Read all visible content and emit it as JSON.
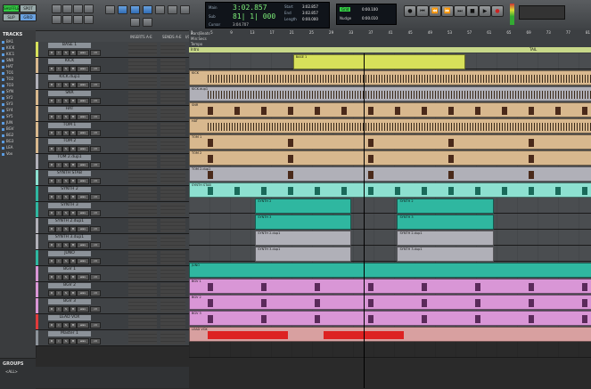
{
  "toolbar": {
    "modes": [
      "SHUFFLE",
      "SPOT",
      "SLIP",
      "GRID"
    ],
    "counter": {
      "main_label": "Main",
      "main_value": "3:02.857",
      "sub_label": "Sub",
      "sub_value": "81| 1| 000",
      "start_label": "Start",
      "start_value": "3:02.857",
      "end_label": "End",
      "end_value": "3:02.857",
      "length_label": "Length",
      "length_value": "0:00.000",
      "cursor_label": "Cursor",
      "cursor_value": "3:04.707"
    },
    "grid": {
      "label": "Grid",
      "value": "0:00.100",
      "nudge_label": "Nudge",
      "nudge_value": "0:00.010"
    }
  },
  "tracklist": {
    "title": "TRACKS",
    "items": [
      "BA1",
      "KICK",
      "KIC1",
      "SNR",
      "HAT",
      "TO1",
      "TO2",
      "TO3",
      "SYN",
      "SY2",
      "SY3",
      "SY4",
      "SY5",
      "JUN",
      "BGV",
      "BG2",
      "BG3",
      "LEA",
      "Vox"
    ]
  },
  "groups": {
    "title": "GROUPS",
    "all": "<ALL>"
  },
  "column_headers": {
    "inserts": "INSERTS A-E",
    "sends": "SENDS A-E",
    "io": "I/O"
  },
  "ruler": [
    "Bars|Beats",
    "Min:Secs",
    "Tempo",
    "Markers"
  ],
  "ruler_bars": [
    "1",
    "5",
    "9",
    "13",
    "17",
    "21",
    "25",
    "29",
    "33",
    "37",
    "41",
    "45",
    "49",
    "53",
    "57",
    "61",
    "65",
    "69",
    "73",
    "77",
    "81"
  ],
  "markers": {
    "intro": "Intro",
    "tail": "TAIL"
  },
  "tracks": [
    {
      "name": "BASE 1",
      "color": "#d7e15a",
      "io": "BASS",
      "vol": "-10.7",
      "clips": [
        [
          22,
          58
        ]
      ],
      "ctype": "wave"
    },
    {
      "name": "KICK",
      "color": "#d8b88e",
      "io": "DrmSub",
      "vol": "0.0",
      "clips": [
        [
          0,
          85
        ]
      ],
      "ctype": "dense"
    },
    {
      "name": "KICK.dup1",
      "color": "#b0b0b8",
      "io": "DrmSub",
      "vol": "0.0",
      "clips": [
        [
          0,
          85
        ]
      ],
      "ctype": "dense"
    },
    {
      "name": "SNR",
      "color": "#d8b88e",
      "io": "DrmSub",
      "vol": "0.0",
      "clips": [
        [
          0,
          85
        ]
      ],
      "ctype": "hits"
    },
    {
      "name": "HAT",
      "color": "#d8b88e",
      "io": "DrmSub",
      "vol": "0.0",
      "clips": [
        [
          0,
          85
        ]
      ],
      "ctype": "dense2"
    },
    {
      "name": "TOM 1",
      "color": "#d8b88e",
      "io": "DrmSub",
      "vol": "0.0",
      "clips": [
        [
          0,
          85
        ]
      ],
      "ctype": "sparse"
    },
    {
      "name": "TOM 2",
      "color": "#d8b88e",
      "io": "DrmSub",
      "vol": "0.0",
      "clips": [
        [
          0,
          85
        ]
      ],
      "ctype": "sparse"
    },
    {
      "name": "TOM 2.dup1",
      "color": "#b0b0b8",
      "io": "DrmSub",
      "vol": "0.0",
      "clips": [
        [
          0,
          85
        ]
      ],
      "ctype": "sparse"
    },
    {
      "name": "SYNTH STAB",
      "color": "#8de0d0",
      "io": "SynSub",
      "vol": "0.0",
      "clips": [
        [
          0,
          85
        ]
      ],
      "ctype": "stab"
    },
    {
      "name": "SYNTH 2",
      "color": "#2fb7a0",
      "io": "SynSub",
      "vol": "+6.0",
      "clips": [
        [
          14,
          34
        ],
        [
          44,
          64
        ]
      ],
      "ctype": "block"
    },
    {
      "name": "SYNTH 3",
      "color": "#2fb7a0",
      "io": "SynSub",
      "vol": "0.0",
      "clips": [
        [
          14,
          34
        ],
        [
          44,
          64
        ]
      ],
      "ctype": "block"
    },
    {
      "name": "SYNTH 2.dup1",
      "color": "#b0b0b8",
      "io": "SynSub",
      "vol": "0.0",
      "clips": [
        [
          14,
          34
        ],
        [
          44,
          64
        ]
      ],
      "ctype": "block"
    },
    {
      "name": "SYNTH 3.dup1",
      "color": "#b0b0b8",
      "io": "SynSub",
      "vol": "0.0",
      "clips": [
        [
          14,
          34
        ],
        [
          44,
          64
        ]
      ],
      "ctype": "block"
    },
    {
      "name": "JUNO",
      "color": "#2fb7a0",
      "io": "SynSub",
      "vol": "0.0",
      "clips": [
        [
          0,
          85
        ]
      ],
      "ctype": "wave"
    },
    {
      "name": "BGV 1",
      "color": "#d996d6",
      "io": "BGV",
      "vol": "0.0",
      "clips": [
        [
          0,
          85
        ]
      ],
      "ctype": "vox"
    },
    {
      "name": "BGV 2",
      "color": "#d996d6",
      "io": "BGV",
      "vol": "0.0",
      "clips": [
        [
          0,
          85
        ]
      ],
      "ctype": "vox"
    },
    {
      "name": "BGV 3",
      "color": "#d996d6",
      "io": "BGV",
      "vol": "0.0",
      "clips": [
        [
          0,
          85
        ]
      ],
      "ctype": "vox"
    },
    {
      "name": "LEAD VOX",
      "color": "#e03a3a",
      "io": "LdVx",
      "vol": "0.0",
      "clips": [
        [
          0,
          85
        ]
      ],
      "ctype": "lead"
    },
    {
      "name": "Master 1",
      "color": "#8c9299",
      "io": "Out",
      "vol": "0.0",
      "clips": [],
      "ctype": "none"
    }
  ]
}
